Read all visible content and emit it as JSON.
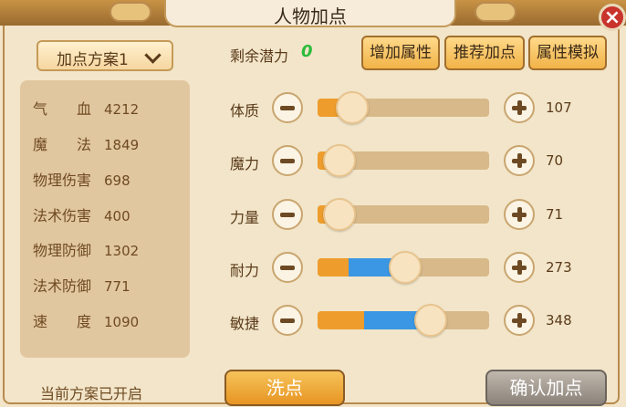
{
  "window": {
    "title": "人物加点",
    "close_label": "×"
  },
  "plan": {
    "dropdown_label": "加点方案1",
    "status_text": "当前方案已开启"
  },
  "stats": [
    {
      "label": "气　　血",
      "value": "4212"
    },
    {
      "label": "魔　　法",
      "value": "1849"
    },
    {
      "label": "物理伤害",
      "value": "698"
    },
    {
      "label": "法术伤害",
      "value": "400"
    },
    {
      "label": "物理防御",
      "value": "1302"
    },
    {
      "label": "法术防御",
      "value": "771"
    },
    {
      "label": "速　　度",
      "value": "1090"
    }
  ],
  "potential": {
    "label": "剩余潜力",
    "value": "0"
  },
  "top_buttons": {
    "add_attr": "增加属性",
    "recommend": "推荐加点",
    "simulate": "属性模拟"
  },
  "attributes": [
    {
      "label": "体质",
      "value": "107",
      "orange_fraction": 0.2,
      "blue_fraction": 0.0,
      "slider_fraction": 0.2
    },
    {
      "label": "魔力",
      "value": "70",
      "orange_fraction": 0.13,
      "blue_fraction": 0.0,
      "slider_fraction": 0.13
    },
    {
      "label": "力量",
      "value": "71",
      "orange_fraction": 0.13,
      "blue_fraction": 0.0,
      "slider_fraction": 0.13
    },
    {
      "label": "耐力",
      "value": "273",
      "orange_fraction": 0.18,
      "blue_fraction": 0.33,
      "slider_fraction": 0.51
    },
    {
      "label": "敏捷",
      "value": "348",
      "orange_fraction": 0.27,
      "blue_fraction": 0.4,
      "slider_fraction": 0.66
    }
  ],
  "bottom_buttons": {
    "wash": "洗点",
    "confirm": "确认加点"
  },
  "colors": {
    "orange_fill": "#ee9d2c",
    "blue_fill": "#3b97e3",
    "potential_green": "#2bbb3b",
    "close_red": "#c8332b"
  }
}
